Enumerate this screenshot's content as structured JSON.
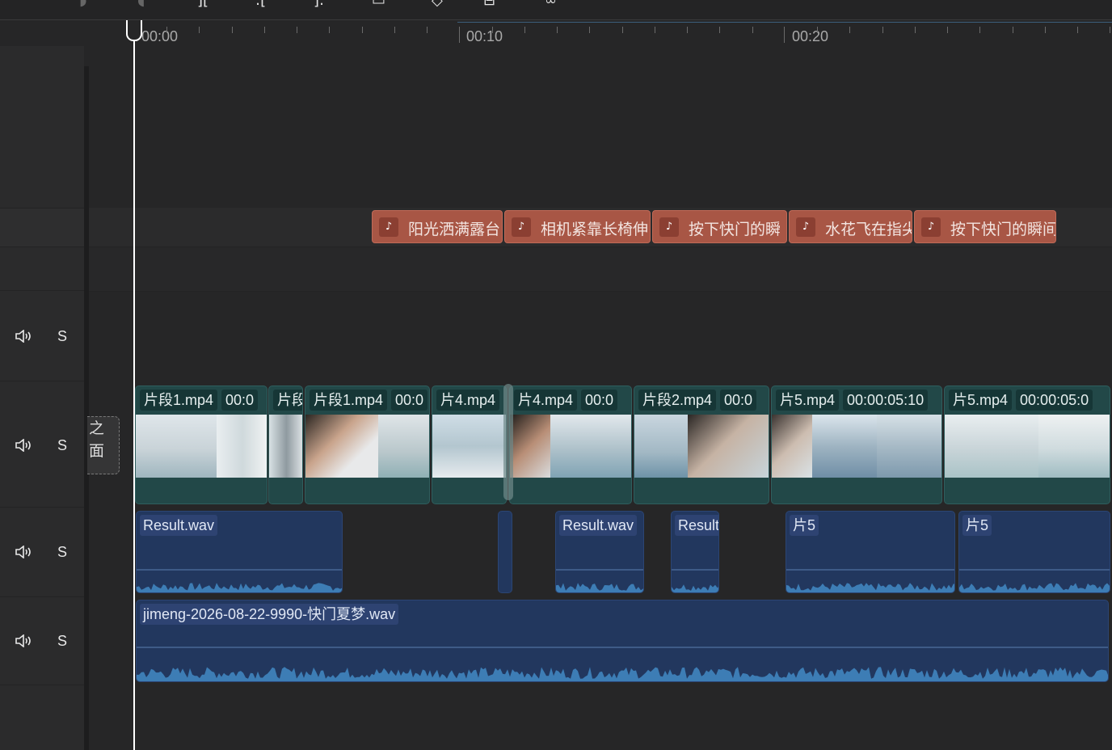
{
  "ruler": {
    "labels": [
      "00:00",
      "00:10",
      "00:20"
    ]
  },
  "tracks": [
    {
      "name": "audio-track-1",
      "mute_icon": "volume-icon",
      "solo_label": "S"
    },
    {
      "name": "video-track-main",
      "mute_icon": "volume-icon",
      "solo_label": "S"
    },
    {
      "name": "audio-track-2",
      "mute_icon": "volume-icon",
      "solo_label": "S"
    },
    {
      "name": "audio-track-3",
      "mute_icon": "volume-icon",
      "solo_label": "S"
    }
  ],
  "cover": {
    "label_top": "之",
    "label_bottom": "面"
  },
  "text_clips": [
    {
      "icon": "text-to-speech-icon",
      "label": "阳光洒满露台"
    },
    {
      "icon": "text-to-speech-icon",
      "label": "相机紧靠长椅伸"
    },
    {
      "icon": "text-to-speech-icon",
      "label": "按下快门的瞬"
    },
    {
      "icon": "text-to-speech-icon",
      "label": "水花飞在指尖"
    },
    {
      "icon": "text-to-speech-icon",
      "label": "按下快门的瞬间"
    }
  ],
  "video_clips": [
    {
      "name": "片段1.mp4",
      "time": "00:0"
    },
    {
      "name": "片段",
      "time": ""
    },
    {
      "name": "片段1.mp4",
      "time": "00:0"
    },
    {
      "name": "片4.mp4",
      "time": ""
    },
    {
      "name": "片4.mp4",
      "time": "00:0"
    },
    {
      "name": "片段2.mp4",
      "time": "00:0"
    },
    {
      "name": "片5.mp4",
      "time": "00:00:05:10"
    },
    {
      "name": "片5.mp4",
      "time": "00:00:05:0"
    }
  ],
  "audio_clips": [
    {
      "label": "Result.wav"
    },
    {
      "label": ""
    },
    {
      "label": "Result.wav"
    },
    {
      "label": "Result"
    },
    {
      "label": "片5"
    },
    {
      "label": "片5"
    }
  ],
  "music_clip": {
    "label": "jimeng-2026-08-22-9990-快门夏梦.wav"
  },
  "colors": {
    "background": "#262627",
    "text_clip": "#a85645",
    "video_clip": "#224848",
    "audio_clip": "#22375e",
    "waveform": "#3d7db5"
  }
}
